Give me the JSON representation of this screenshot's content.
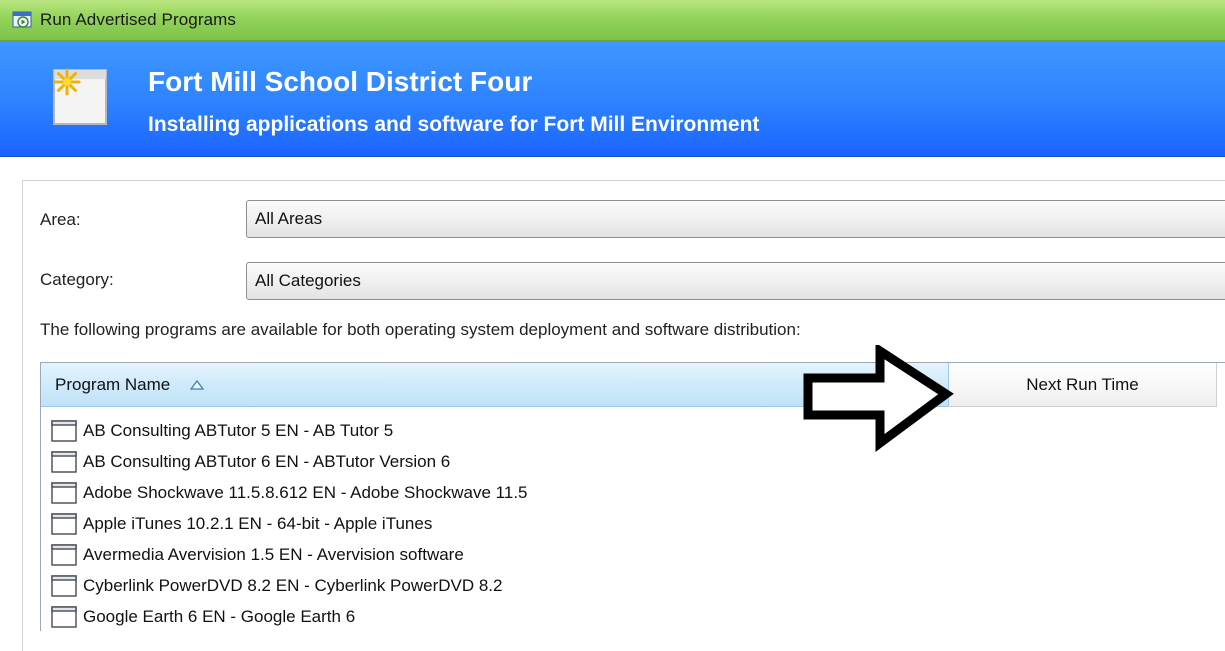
{
  "window": {
    "title": "Run Advertised Programs",
    "icon": "run-program-icon"
  },
  "banner": {
    "title": "Fort Mill School District Four",
    "subtitle": "Installing applications and software for Fort Mill Environment",
    "icon": "new-window-icon"
  },
  "filters": {
    "area_label": "Area:",
    "area_value": "All Areas",
    "category_label": "Category:",
    "category_value": "All Categories"
  },
  "info_text": "The following programs are available for both operating system deployment and software distribution:",
  "list": {
    "columns": [
      "Program Name",
      "Next Run Time"
    ],
    "sort_indicator": "ascending",
    "rows": [
      "AB Consulting ABTutor 5 EN - AB Tutor 5",
      "AB Consulting ABTutor 6 EN - ABTutor Version 6",
      "Adobe Shockwave 11.5.8.612 EN - Adobe Shockwave 11.5",
      "Apple iTunes 10.2.1 EN - 64-bit - Apple iTunes",
      "Avermedia Avervision 1.5 EN - Avervision software",
      "Cyberlink PowerDVD 8.2 EN - Cyberlink PowerDVD 8.2",
      "Google Earth 6 EN - Google Earth 6"
    ]
  },
  "colors": {
    "titlebar": "#93d35a",
    "banner": "#2d82ff",
    "header_selected": "#cfeafa"
  }
}
